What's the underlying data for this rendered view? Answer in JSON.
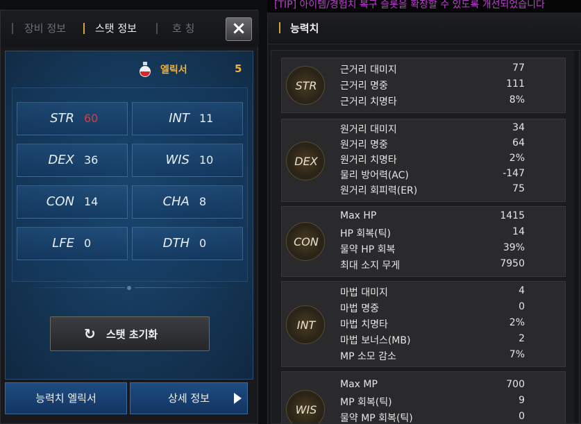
{
  "tip": "[TIP] 아이템/경험치 복구 슬롯을 확장할 수 있도록 개선되었습니다",
  "tabs": [
    {
      "label": "장비 정보",
      "active": false
    },
    {
      "label": "스탯 정보",
      "active": true
    },
    {
      "label": "호 칭",
      "active": false
    }
  ],
  "close_icon": "×",
  "elixir": {
    "label": "엘릭서",
    "count": "5",
    "icon": "potion-icon"
  },
  "stats": [
    {
      "name": "STR",
      "value": "60",
      "highlight": true
    },
    {
      "name": "INT",
      "value": "11",
      "highlight": false
    },
    {
      "name": "DEX",
      "value": "36",
      "highlight": false
    },
    {
      "name": "WIS",
      "value": "10",
      "highlight": false
    },
    {
      "name": "CON",
      "value": "14",
      "highlight": false
    },
    {
      "name": "CHA",
      "value": "8",
      "highlight": false
    },
    {
      "name": "LFE",
      "value": "0",
      "highlight": false
    },
    {
      "name": "DTH",
      "value": "0",
      "highlight": false
    }
  ],
  "reset_button": {
    "label": "스탯 초기화",
    "icon": "↻"
  },
  "bottom_buttons": {
    "elixir": "능력치 엘릭서",
    "detail": "상세 정보"
  },
  "right": {
    "title": "능력치",
    "categories": [
      {
        "label": "STR",
        "rows": [
          {
            "name": "근거리 대미지",
            "value": "77"
          },
          {
            "name": "근거리 명중",
            "value": "111"
          },
          {
            "name": "근거리 치명타",
            "value": "8%"
          }
        ]
      },
      {
        "label": "DEX",
        "rows": [
          {
            "name": "원거리 대미지",
            "value": "34"
          },
          {
            "name": "원거리 명중",
            "value": "64"
          },
          {
            "name": "원거리 치명타",
            "value": "2%"
          },
          {
            "name": "물리 방어력(AC)",
            "value": "-147"
          },
          {
            "name": "원거리 회피력(ER)",
            "value": "75"
          }
        ]
      },
      {
        "label": "CON",
        "rows": [
          {
            "name": "Max HP",
            "value": "1415"
          },
          {
            "name": "HP 회복(틱)",
            "value": "14"
          },
          {
            "name": "물약 HP 회복",
            "value": "39%"
          },
          {
            "name": "최대 소지 무게",
            "value": "7950"
          }
        ]
      },
      {
        "label": "INT",
        "rows": [
          {
            "name": "마법 대미지",
            "value": "4"
          },
          {
            "name": "마법 명중",
            "value": "0"
          },
          {
            "name": "마법 치명타",
            "value": "2%"
          },
          {
            "name": "마법 보너스(MB)",
            "value": "2"
          },
          {
            "name": "MP 소모 감소",
            "value": "7%"
          }
        ]
      },
      {
        "label": "WIS",
        "rows": [
          {
            "name": "Max MP",
            "value": "700"
          },
          {
            "name": "MP 회복(틱)",
            "value": "9"
          },
          {
            "name": "물약 MP 회복(틱)",
            "value": "0"
          }
        ]
      }
    ]
  }
}
